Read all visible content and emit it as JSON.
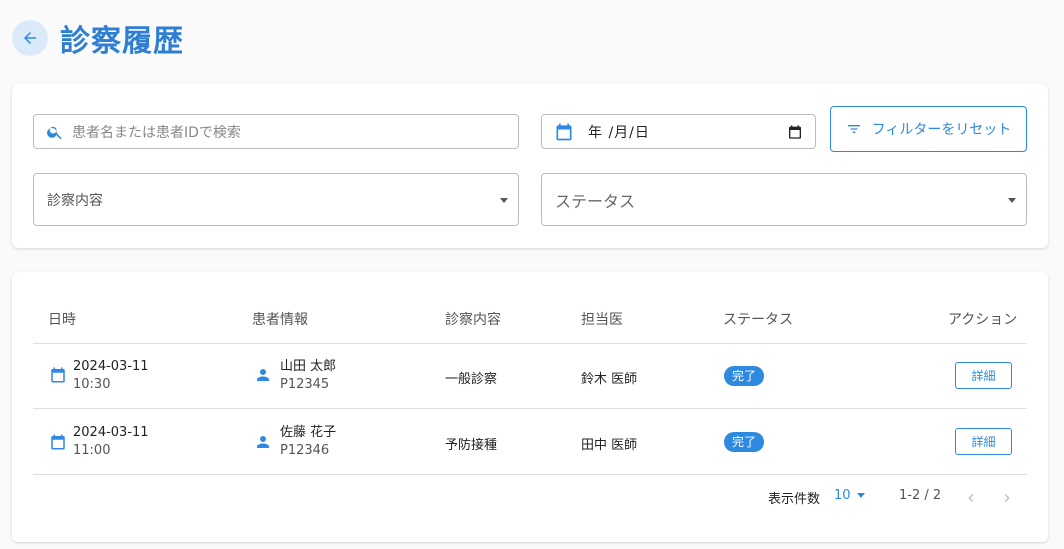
{
  "header": {
    "title": "診察履歴"
  },
  "filters": {
    "search_placeholder": "患者名または患者IDで検索",
    "date_display": "年 /月/日",
    "reset_label": "フィルターをリセット",
    "content_select_label": "診察内容",
    "status_select_label": "ステータス"
  },
  "table": {
    "headers": [
      "日時",
      "患者情報",
      "診察内容",
      "担当医",
      "ステータス",
      "アクション"
    ],
    "rows": [
      {
        "date": "2024-03-11",
        "time": "10:30",
        "patient_name": "山田 太郎",
        "patient_id": "P12345",
        "content": "一般診察",
        "doctor": "鈴木 医師",
        "status": "完了",
        "action": "詳細"
      },
      {
        "date": "2024-03-11",
        "time": "11:00",
        "patient_name": "佐藤 花子",
        "patient_id": "P12346",
        "content": "予防接種",
        "doctor": "田中 医師",
        "status": "完了",
        "action": "詳細"
      }
    ]
  },
  "pagination": {
    "per_page_label": "表示件数",
    "per_page_value": "10",
    "range": "1-2 / 2"
  },
  "colors": {
    "accent": "#2d8ae0",
    "title": "#2d7fd3"
  }
}
